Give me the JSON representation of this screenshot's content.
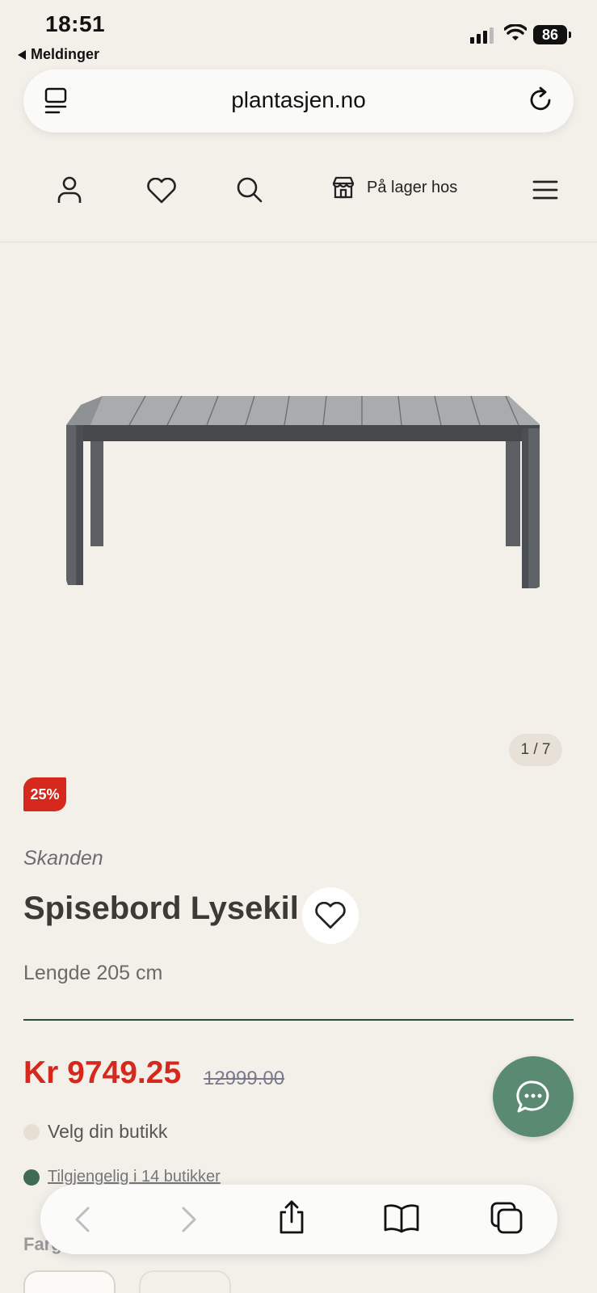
{
  "status_bar": {
    "time": "18:51",
    "back_app": "Meldinger",
    "battery": "86"
  },
  "browser": {
    "url": "plantasjen.no"
  },
  "site_header": {
    "stock_label": "På lager hos"
  },
  "product": {
    "image_counter": "1 / 7",
    "discount_badge": "25%",
    "brand": "Skanden",
    "title": "Spisebord Lysekil",
    "subtitle": "Lengde 205 cm",
    "price": "Kr 9749.25",
    "old_price": "12999.00",
    "store_prompt": "Velg din butikk",
    "availability": "Tilgjengelig i 14 butikker",
    "color_label": "Farge"
  },
  "colors": {
    "accent_green": "#5a8a72",
    "sale_red": "#d6281c",
    "background": "#f3f0ea",
    "available_dot": "#3f6b55",
    "store_dot": "#e8dfd3"
  }
}
